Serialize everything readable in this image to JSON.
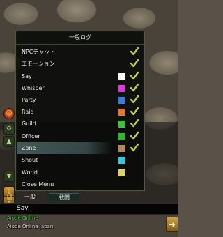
{
  "menu": {
    "title": "一般ログ",
    "items": [
      {
        "label": "NPCチャット",
        "checked": true,
        "color": null
      },
      {
        "label": "エモーション",
        "checked": true,
        "color": null
      },
      {
        "label": "Say",
        "checked": true,
        "color": "#ffffff"
      },
      {
        "label": "Whisper",
        "checked": true,
        "color": "#d63bd6"
      },
      {
        "label": "Party",
        "checked": true,
        "color": "#3a7ad9"
      },
      {
        "label": "Raid",
        "checked": true,
        "color": "#e07a2a"
      },
      {
        "label": "Guild",
        "checked": true,
        "color": "#3fc23a"
      },
      {
        "label": "Officer",
        "checked": true,
        "color": "#2fb82f"
      },
      {
        "label": "Zone",
        "checked": true,
        "color": "#b08860",
        "highlighted": true
      },
      {
        "label": "Shout",
        "checked": false,
        "color": "#35c8d8"
      },
      {
        "label": "World",
        "checked": false,
        "color": "#e0d070"
      },
      {
        "label": "Close Menu",
        "checked": false,
        "color": null
      }
    ]
  },
  "tabs": [
    {
      "label": "一般",
      "active": false
    },
    {
      "label": "戦闘",
      "active": true
    }
  ],
  "chat_input": {
    "label": "Say:",
    "value": ""
  },
  "zone_text": {
    "line1": "Aiode Online",
    "line2": "Aiode Online Japan"
  },
  "colors": {
    "check": "#b9d04a",
    "menu_border": "#4e5a3c",
    "highlight": "#465c5c"
  },
  "icons": {
    "check": "checkmark-icon",
    "lock": "lock-icon",
    "corner": "arrow-icon"
  }
}
